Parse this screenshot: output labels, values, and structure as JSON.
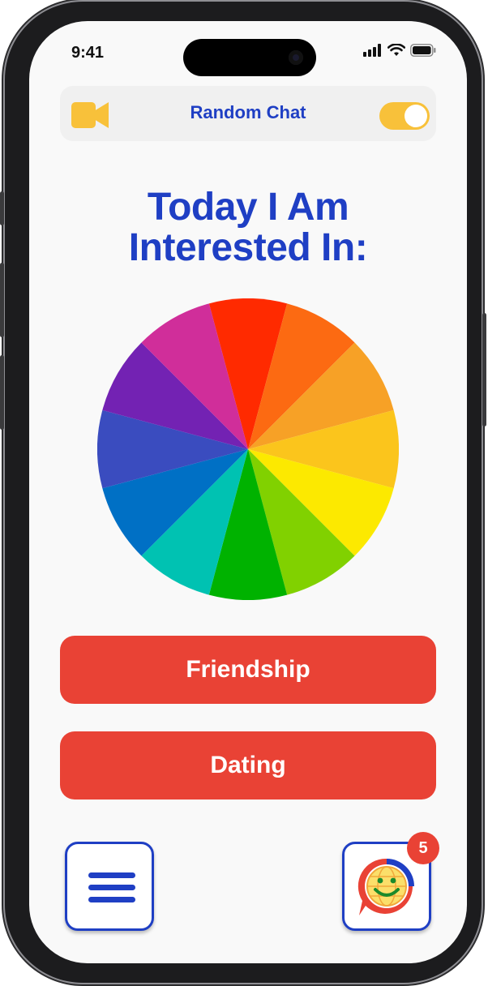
{
  "status_bar": {
    "time": "9:41"
  },
  "header": {
    "title": "Random Chat",
    "video_icon": "video-camera-icon",
    "toggle_on": true
  },
  "main": {
    "heading_line1": "Today I Am",
    "heading_line2": "Interested In:",
    "wheel_icon": "color-wheel",
    "wheel_colors": [
      "#ff2a00",
      "#fc6a12",
      "#f7a126",
      "#fbc51c",
      "#fce900",
      "#81d100",
      "#00b200",
      "#00c2b2",
      "#0070c5",
      "#3a4cbf",
      "#7322b3",
      "#d02e9a"
    ]
  },
  "buttons": {
    "friendship": "Friendship",
    "dating": "Dating"
  },
  "bottom_bar": {
    "menu_icon": "hamburger-menu-icon",
    "chat_icon": "smiley-globe-chat-icon",
    "badge_count": "5"
  },
  "colors": {
    "primary_blue": "#1f3fc4",
    "accent_red": "#e94235",
    "accent_yellow": "#f8c13a",
    "background": "#f9f9f9"
  }
}
